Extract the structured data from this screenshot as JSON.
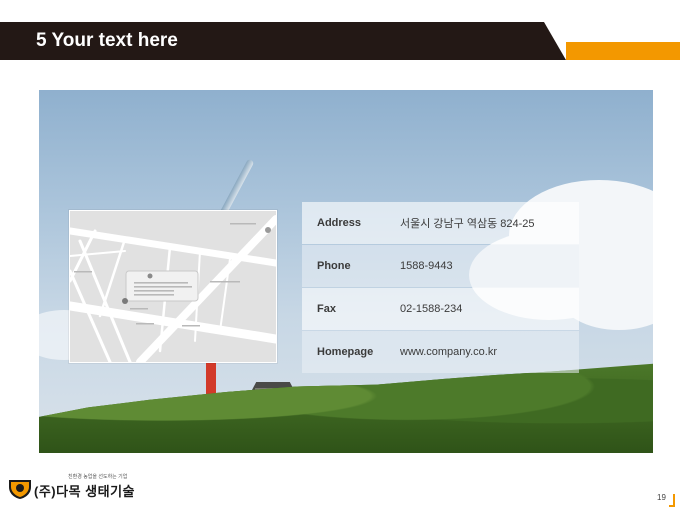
{
  "slide": {
    "title": "5 Your text here",
    "accent_color": "#f39800",
    "title_bar_color": "#231815"
  },
  "contact": {
    "rows": [
      {
        "label": "Address",
        "value": "서울시 강남구 역삼동 824-25"
      },
      {
        "label": "Phone",
        "value": "1588-9443"
      },
      {
        "label": "Fax",
        "value": "02-1588-234"
      },
      {
        "label": "Homepage",
        "value": "www.company.co.kr"
      }
    ]
  },
  "footer": {
    "logo_tagline": "친환경 농업을 선도하는 기업",
    "logo_name": "(주)다목 생태기술",
    "page_number": "19"
  }
}
